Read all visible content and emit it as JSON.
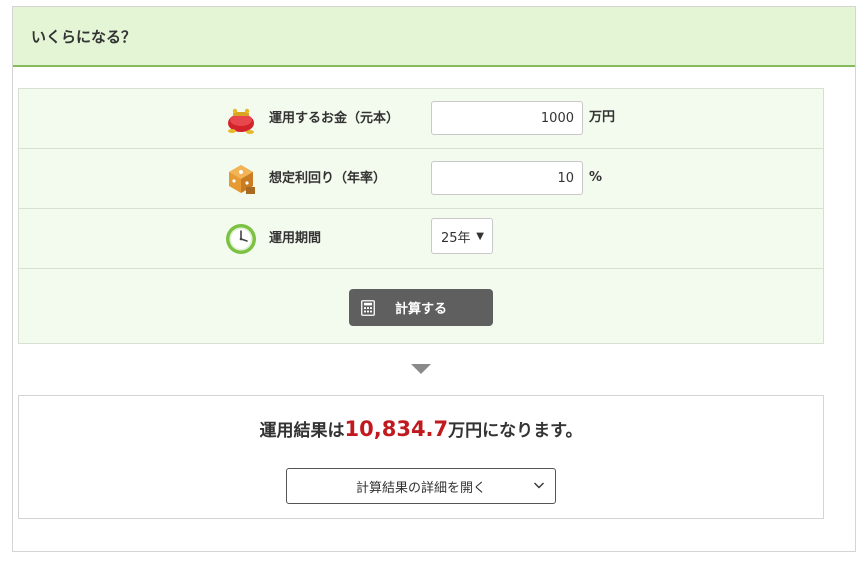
{
  "header": {
    "title": "いくらになる？"
  },
  "form": {
    "principal": {
      "label": "運用するお金（元本）",
      "value": "1000",
      "unit": "万円",
      "icon": "coin-purse-icon"
    },
    "rate": {
      "label": "想定利回り（年率）",
      "value": "10",
      "unit": "%",
      "icon": "dice-cube-icon"
    },
    "period": {
      "label": "運用期間",
      "selected": "25年",
      "icon": "clock-icon"
    },
    "calculate": {
      "label": "計算する",
      "icon": "calculator-icon"
    }
  },
  "result": {
    "prefix": "運用結果は",
    "value": "10,834.7",
    "suffix": "万円になります。",
    "detail_button": "計算結果の詳細を開く"
  },
  "colors": {
    "header_bg": "#e3f5d5",
    "header_border": "#85bb5e",
    "form_bg": "#f3fbee",
    "button_bg": "#5f5f5f",
    "result_value": "#c0191e"
  }
}
